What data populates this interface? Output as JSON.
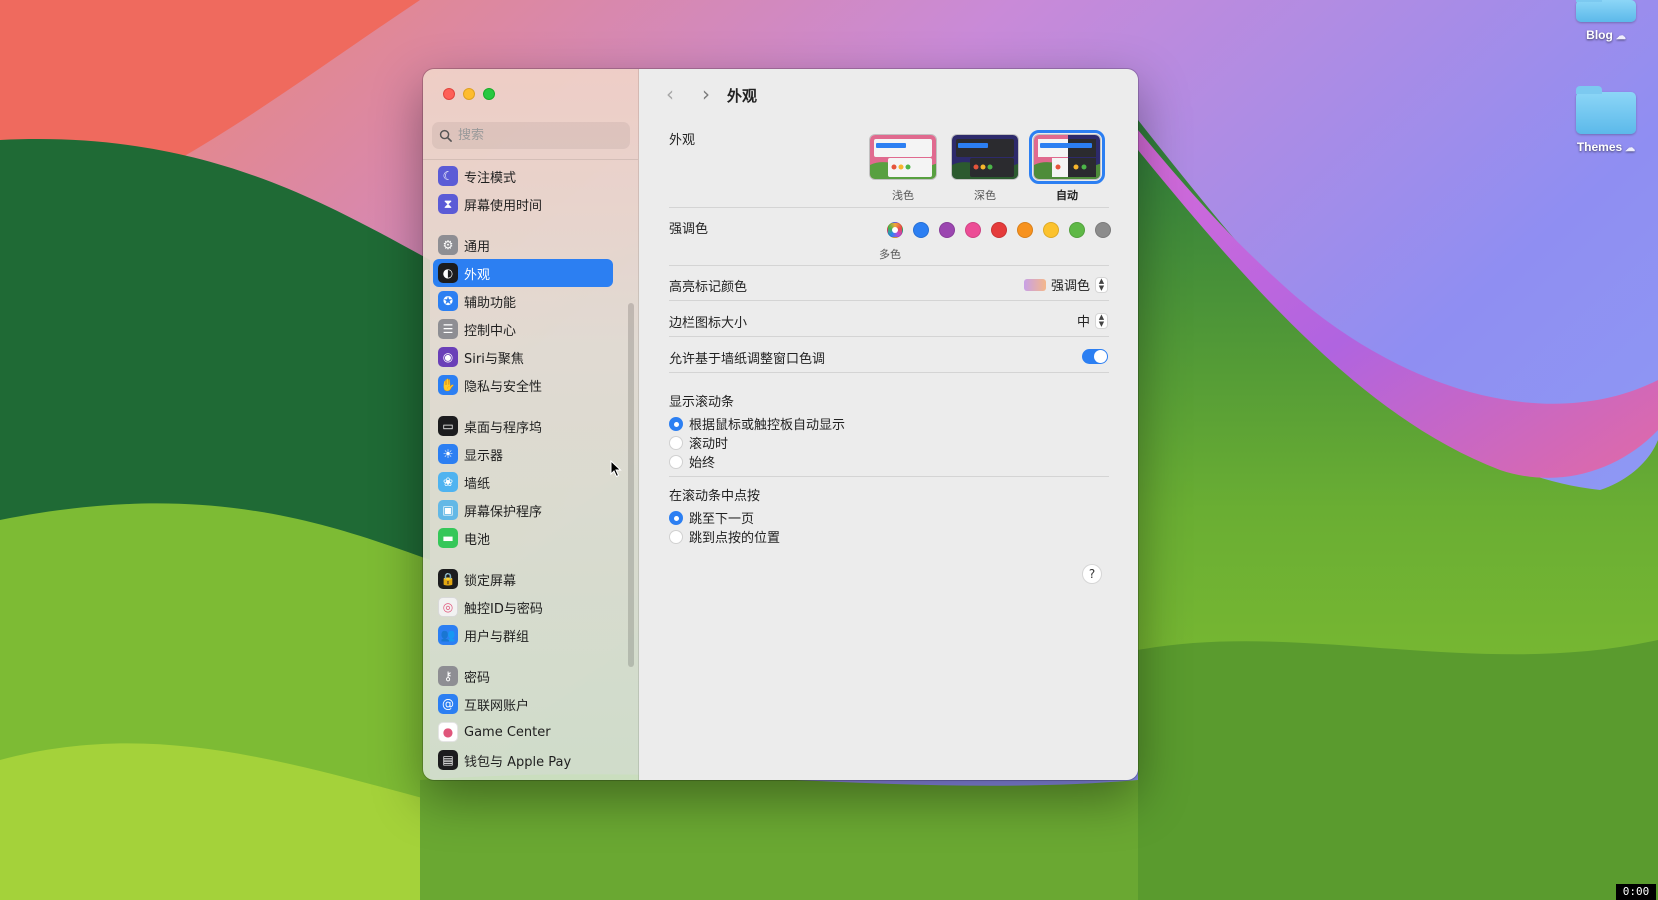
{
  "desktop": {
    "icons": [
      {
        "label": "Blog",
        "icon": "folder-icon"
      },
      {
        "label": "Themes",
        "icon": "folder-icon"
      }
    ]
  },
  "sidebar": {
    "search_placeholder": "搜索",
    "groups": [
      [
        {
          "label": "专注模式",
          "icon": "moon-icon",
          "color": "#5b5bd6"
        },
        {
          "label": "屏幕使用时间",
          "icon": "hourglass-icon",
          "color": "#5b5bd6"
        }
      ],
      [
        {
          "label": "通用",
          "icon": "gear-icon",
          "color": "#8e8e93"
        },
        {
          "label": "外观",
          "icon": "appearance-icon",
          "color": "#1c1c1e",
          "selected": true
        },
        {
          "label": "辅助功能",
          "icon": "accessibility-icon",
          "color": "#2c7ff2"
        },
        {
          "label": "控制中心",
          "icon": "control-center-icon",
          "color": "#8e8e93"
        },
        {
          "label": "Siri与聚焦",
          "icon": "siri-icon",
          "color": "#6a3fb8"
        },
        {
          "label": "隐私与安全性",
          "icon": "hand-icon",
          "color": "#2c7ff2"
        }
      ],
      [
        {
          "label": "桌面与程序坞",
          "icon": "dock-icon",
          "color": "#1c1c1e"
        },
        {
          "label": "显示器",
          "icon": "sun-icon",
          "color": "#2c7ff2"
        },
        {
          "label": "墙纸",
          "icon": "flower-icon",
          "color": "#4fb3f0"
        },
        {
          "label": "屏幕保护程序",
          "icon": "screensaver-icon",
          "color": "#63b8e6"
        },
        {
          "label": "电池",
          "icon": "battery-icon",
          "color": "#35c759"
        }
      ],
      [
        {
          "label": "锁定屏幕",
          "icon": "lock-icon",
          "color": "#1c1c1e"
        },
        {
          "label": "触控ID与密码",
          "icon": "fingerprint-icon",
          "color": "#f2f2f2"
        },
        {
          "label": "用户与群组",
          "icon": "users-icon",
          "color": "#2c7ff2"
        }
      ],
      [
        {
          "label": "密码",
          "icon": "key-icon",
          "color": "#8e8e93"
        },
        {
          "label": "互联网账户",
          "icon": "at-icon",
          "color": "#2c7ff2"
        },
        {
          "label": "Game Center",
          "icon": "game-center-icon",
          "color": "#ffffff"
        },
        {
          "label": "钱包与 Apple Pay",
          "icon": "wallet-icon",
          "color": "#1c1c1e"
        }
      ]
    ]
  },
  "pane": {
    "title": "外观",
    "appearance": {
      "label": "外观",
      "options": [
        {
          "label": "浅色",
          "selected": false
        },
        {
          "label": "深色",
          "selected": false
        },
        {
          "label": "自动",
          "selected": true
        }
      ]
    },
    "accent": {
      "label": "强调色",
      "colors": [
        "multicolor",
        "#2c7ff2",
        "#9b46b0",
        "#ec4d96",
        "#e53b3b",
        "#f7921e",
        "#fcc22d",
        "#5eb846",
        "#8c8c8c"
      ],
      "selected_caption": "多色"
    },
    "highlight": {
      "label": "高亮标记颜色",
      "value": "强调色"
    },
    "sidebar_icon_size": {
      "label": "边栏图标大小",
      "value": "中"
    },
    "wallpaper_tinting": {
      "label": "允许基于墙纸调整窗口色调",
      "on": true
    },
    "show_scrollbars": {
      "label": "显示滚动条",
      "options": [
        {
          "label": "根据鼠标或触控板自动显示",
          "selected": true
        },
        {
          "label": "滚动时",
          "selected": false
        },
        {
          "label": "始终",
          "selected": false
        }
      ]
    },
    "click_scrollbar": {
      "label": "在滚动条中点按",
      "options": [
        {
          "label": "跳至下一页",
          "selected": true
        },
        {
          "label": "跳到点按的位置",
          "selected": false
        }
      ]
    },
    "help": "?"
  },
  "clock": "0:00"
}
